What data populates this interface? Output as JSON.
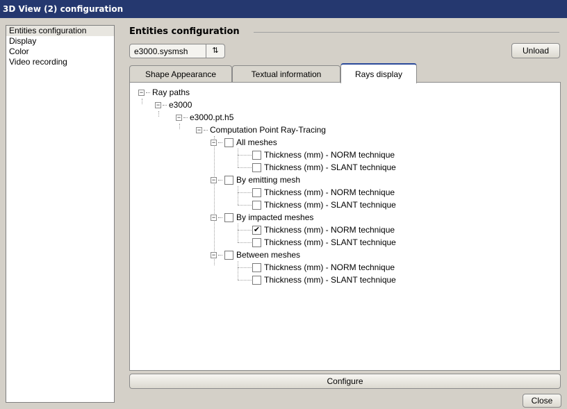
{
  "window": {
    "title": "3D View (2) configuration"
  },
  "sidebar": {
    "items": [
      {
        "label": "Entities configuration"
      },
      {
        "label": "Display"
      },
      {
        "label": "Color"
      },
      {
        "label": "Video recording"
      }
    ]
  },
  "panel": {
    "title": "Entities configuration",
    "combo_value": "e3000.sysmsh",
    "unload_label": "Unload",
    "tabs": [
      {
        "label": "Shape Appearance",
        "active": false
      },
      {
        "label": "Textual information",
        "active": false
      },
      {
        "label": "Rays display",
        "active": true
      }
    ],
    "configure_label": "Configure",
    "close_label": "Close"
  },
  "tree": {
    "root": "Ray paths",
    "file": "e3000",
    "result": "e3000.pt.h5",
    "computation": "Computation Point Ray-Tracing",
    "groups": [
      {
        "label": "All meshes",
        "checked": false,
        "items": [
          {
            "label": "Thickness (mm) - NORM technique",
            "checked": false
          },
          {
            "label": "Thickness (mm) - SLANT technique",
            "checked": false
          }
        ]
      },
      {
        "label": "By emitting mesh",
        "checked": false,
        "items": [
          {
            "label": "Thickness (mm) - NORM technique",
            "checked": false
          },
          {
            "label": "Thickness (mm) - SLANT technique",
            "checked": false
          }
        ]
      },
      {
        "label": "By impacted meshes",
        "checked": false,
        "items": [
          {
            "label": "Thickness (mm) - NORM technique",
            "checked": true
          },
          {
            "label": "Thickness (mm) - SLANT technique",
            "checked": false
          }
        ]
      },
      {
        "label": "Between meshes",
        "checked": false,
        "items": [
          {
            "label": "Thickness (mm) - NORM technique",
            "checked": false
          },
          {
            "label": "Thickness (mm) - SLANT technique",
            "checked": false
          }
        ]
      }
    ]
  },
  "colors": {
    "titlebar": "#25386f",
    "window_bg": "#d4d0c8",
    "active_tab_accent": "#2a4a9a"
  }
}
